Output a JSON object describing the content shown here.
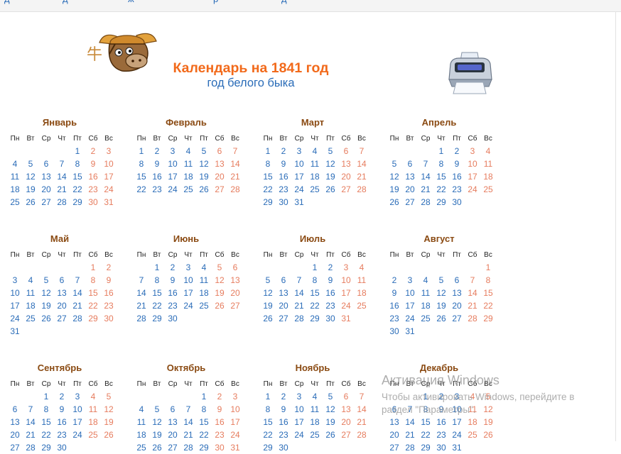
{
  "header": {
    "title": "Календарь на 1841 год",
    "subtitle": "год белого быка",
    "topbar_links": [
      "д",
      "д",
      "ж",
      "р",
      "д"
    ]
  },
  "icons": {
    "logo": "ox-mascot-icon",
    "print": "printer-icon"
  },
  "colors": {
    "title": "#f26a1b",
    "subtitle": "#2a6cb8",
    "month_name": "#8a4a12",
    "weekday_date": "#2a6cb8",
    "weekend_date": "#e67c5e"
  },
  "weekdays": [
    "Пн",
    "Вт",
    "Ср",
    "Чт",
    "Пт",
    "Сб",
    "Вс"
  ],
  "months": [
    {
      "name": "Январь",
      "first_weekday": 5,
      "days": 31
    },
    {
      "name": "Февраль",
      "first_weekday": 1,
      "days": 28
    },
    {
      "name": "Март",
      "first_weekday": 1,
      "days": 31
    },
    {
      "name": "Апрель",
      "first_weekday": 4,
      "days": 30
    },
    {
      "name": "Май",
      "first_weekday": 6,
      "days": 31
    },
    {
      "name": "Июнь",
      "first_weekday": 2,
      "days": 30
    },
    {
      "name": "Июль",
      "first_weekday": 4,
      "days": 31
    },
    {
      "name": "Август",
      "first_weekday": 7,
      "days": 31
    },
    {
      "name": "Сентябрь",
      "first_weekday": 3,
      "days": 30
    },
    {
      "name": "Октябрь",
      "first_weekday": 5,
      "days": 31
    },
    {
      "name": "Ноябрь",
      "first_weekday": 1,
      "days": 30
    },
    {
      "name": "Декабрь",
      "first_weekday": 3,
      "days": 31
    }
  ],
  "watermark": {
    "line1": "Активация Windows",
    "line2": "Чтобы активировать Windows, перейдите в",
    "line3": "раздел \"Параметры\"."
  }
}
